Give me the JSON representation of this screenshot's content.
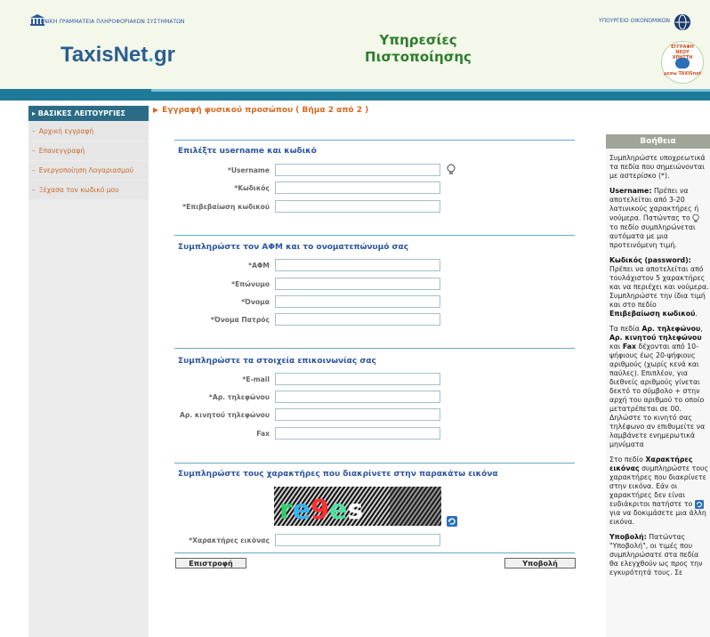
{
  "header": {
    "gsis_label": "ΓΕΝΙΚΗ ΓΡΑΜΜΑΤΕΙΑ ΠΛΗΡΟΦΟΡΙΑΚΩΝ ΣΥΣΤΗΜΑΤΩΝ",
    "brand_prefix": "TaxisNet",
    "brand_dot": ".",
    "brand_suffix": "gr",
    "title_line1": "Υπηρεσίες",
    "title_line2": "Πιστοποίησης",
    "ministry_label": "ΥΠΟΥΡΓΕΙΟ ΟΙΚΟΝΟΜΙΚΩΝ",
    "seal_top_text": "ΕΓΓΡΑΦΗ ΝΕΟΥ ΧΡΗΣΤΗ",
    "seal_caption": "μεσω TAXISnet"
  },
  "sidebar": {
    "heading": "▸ ΒΑΣΙΚΕΣ ΛΕΙΤΟΥΡΓΙΕΣ",
    "items": [
      {
        "label": "Αρχική εγγραφή"
      },
      {
        "label": "Επανεγγραφή"
      },
      {
        "label": "Ενεργοποίηση Λογαριασμού"
      },
      {
        "label": "Ξέχασα τον κωδικό μου"
      }
    ]
  },
  "main": {
    "page_title": "Εγγραφή φυσικού προσώπου ( Βήμα 2 από 2 )",
    "sections": {
      "credentials": {
        "title": "Επιλέξτε username και κωδικό",
        "fields": [
          {
            "label": "*Username",
            "value": ""
          },
          {
            "label": "*Κωδικός",
            "value": ""
          },
          {
            "label": "*Επιβεβαίωση κωδικού",
            "value": ""
          }
        ]
      },
      "identity": {
        "title": "Συμπληρώστε τον ΑΦΜ και το ονοματεπώνυμό σας",
        "fields": [
          {
            "label": "*ΑΦΜ",
            "value": ""
          },
          {
            "label": "*Επώνυμο",
            "value": ""
          },
          {
            "label": "*Όνομα",
            "value": ""
          },
          {
            "label": "*Όνομα Πατρός",
            "value": ""
          }
        ]
      },
      "contact": {
        "title": "Συμπληρώστε τα στοιχεία επικοινωνίας σας",
        "fields": [
          {
            "label": "*E-mail",
            "value": ""
          },
          {
            "label": "*Αρ. τηλεφώνου",
            "value": ""
          },
          {
            "label": "Αρ. κινητού τηλεφώνου",
            "value": ""
          },
          {
            "label": "Fax",
            "value": ""
          }
        ]
      },
      "captcha": {
        "title": "Συμπληρώστε τους χαρακτήρες που διακρίνετε στην παρακάτω εικόνα",
        "image_text": "re9es",
        "field_label": "*Χαρακτήρες εικόνας",
        "field_value": ""
      }
    },
    "back_button": "Επιστροφή",
    "submit_button": "Υποβολή"
  },
  "help": {
    "heading": "Βοήθεια",
    "intro": "Συμπληρώστε υποχρεωτικά τα πεδία που σημειώνονται με αστερίσκο (*).",
    "username_term": "Username:",
    "username_text_a": "Πρέπει να αποτελείται από 3-20 λατινικούς χαρακτήρες ή νούμερα. Πατώντας το",
    "username_text_b": "το πεδίο συμπληρώνεται αυτόματα με μια προτεινόμενη τιμή.",
    "password_term": "Κωδικός (password):",
    "password_text": "Πρέπει να αποτελείται από τουλάχιστον 5 χαρακτήρες και να περιέχει και νούμερα. Συμπληρώστε την ίδια τιμή και στο πεδίο",
    "password_confirm_term": "Επιβεβαίωση κωδικού",
    "phones_pre": "Τα πεδία",
    "phones_term1": "Αρ. τηλεφώνου",
    "phones_term2": "Αρ. κινητού τηλεφώνου",
    "phones_and": "και",
    "phones_term3": "Fax",
    "phones_text": "δέχονται από 10-ψήφιους έως 20-ψήφιους αριθμούς (χωρίς κενά και παύλες). Επιπλέον, για διεθνείς αριθμούς γίνεται δεκτό το σύμβολο + στην αρχή του αριθμού το οποίο μετατρέπεται σε 00. Δηλώστε το κινητό σας τηλέφωνο αν επιθυμείτε να λαμβάνετε ενημερωτικά μηνύματα",
    "captcha_pre": "Στο πεδίο",
    "captcha_term": "Χαρακτήρες εικόνας",
    "captcha_text_a": "συμπληρώστε τους χαρακτήρες που διακρίνετε στην εικόνα. Εάν οι χαρακτήρες δεν είναι ευδιάκριτοι πατήστε το",
    "captcha_text_b": "για να δοκιμάσετε μια άλλη εικόνα.",
    "submit_term": "Υποβολή:",
    "submit_text": "Πατώντας \"Υποβολή\", οι τιμές που συμπληρώσατε στα πεδία θα ελεγχθούν ως προς την εγκυρότητά τους. Σε"
  },
  "colors": {
    "accent_orange": "#d46a20",
    "section_blue": "#2c55a0",
    "bar_teal": "#1f7a9a",
    "title_green": "#2e7d2e"
  }
}
